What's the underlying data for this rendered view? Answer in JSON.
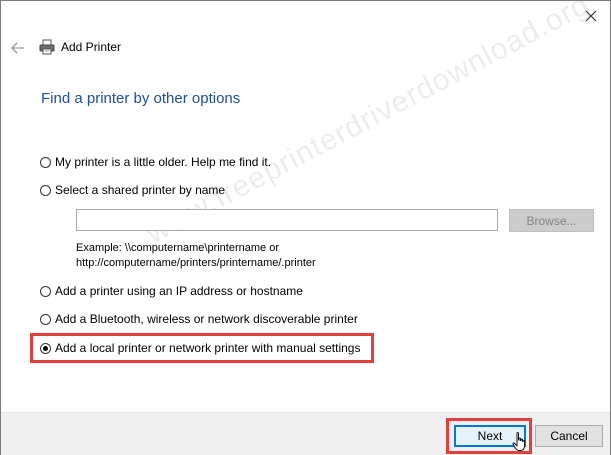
{
  "window": {
    "title": "Add Printer",
    "close_icon": "close-icon",
    "back_icon": "back-arrow-icon",
    "printer_icon": "printer-icon"
  },
  "heading": "Find a printer by other options",
  "options": [
    {
      "label": "My printer is a little older. Help me find it.",
      "checked": false
    },
    {
      "label": "Select a shared printer by name",
      "checked": false
    },
    {
      "label": "Add a printer using an IP address or hostname",
      "checked": false
    },
    {
      "label": "Add a Bluetooth, wireless or network discoverable printer",
      "checked": false
    },
    {
      "label": "Add a local printer or network printer with manual settings",
      "checked": true
    }
  ],
  "shared_printer": {
    "value": "",
    "browse_label": "Browse...",
    "example_line1": "Example: \\\\computername\\printername or",
    "example_line2": "http://computername/printers/printername/.printer"
  },
  "footer": {
    "next_label": "Next",
    "cancel_label": "Cancel"
  },
  "watermark": "www.freeprinterdriverdownload.org",
  "colors": {
    "heading": "#1e4d9f",
    "highlight": "#e53e3e",
    "primary_border": "#0078d7"
  }
}
